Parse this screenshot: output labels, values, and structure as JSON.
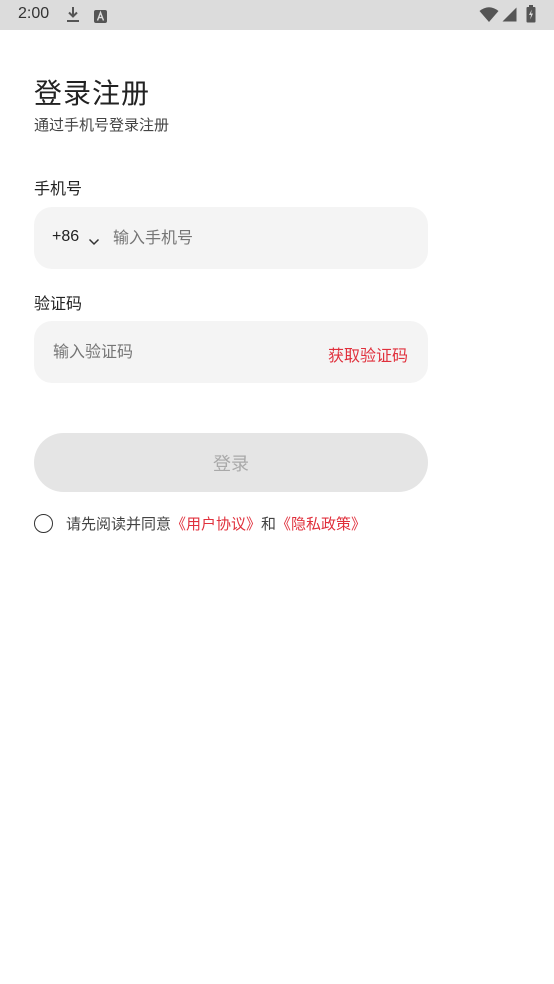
{
  "status_bar": {
    "time": "2:00",
    "icons": [
      "download-icon",
      "accessibility-icon",
      "wifi-icon",
      "signal-icon",
      "battery-icon"
    ]
  },
  "page": {
    "title": "登录注册",
    "subtitle": "通过手机号登录注册"
  },
  "phone": {
    "label": "手机号",
    "country_code": "+86",
    "placeholder": "输入手机号",
    "value": ""
  },
  "code": {
    "label": "验证码",
    "placeholder": "输入验证码",
    "value": "",
    "get_code_label": "获取验证码"
  },
  "login_button": {
    "label": "登录",
    "enabled": false
  },
  "agreement": {
    "checked": false,
    "prefix": "请先阅读并同意",
    "user_agreement": "《用户协议》",
    "conjunction": "和",
    "privacy_policy": "《隐私政策》"
  },
  "colors": {
    "accent": "#e0303c",
    "input_bg": "#f4f4f4",
    "button_disabled_bg": "#e5e5e5",
    "status_bar_bg": "#dcdcdc"
  }
}
